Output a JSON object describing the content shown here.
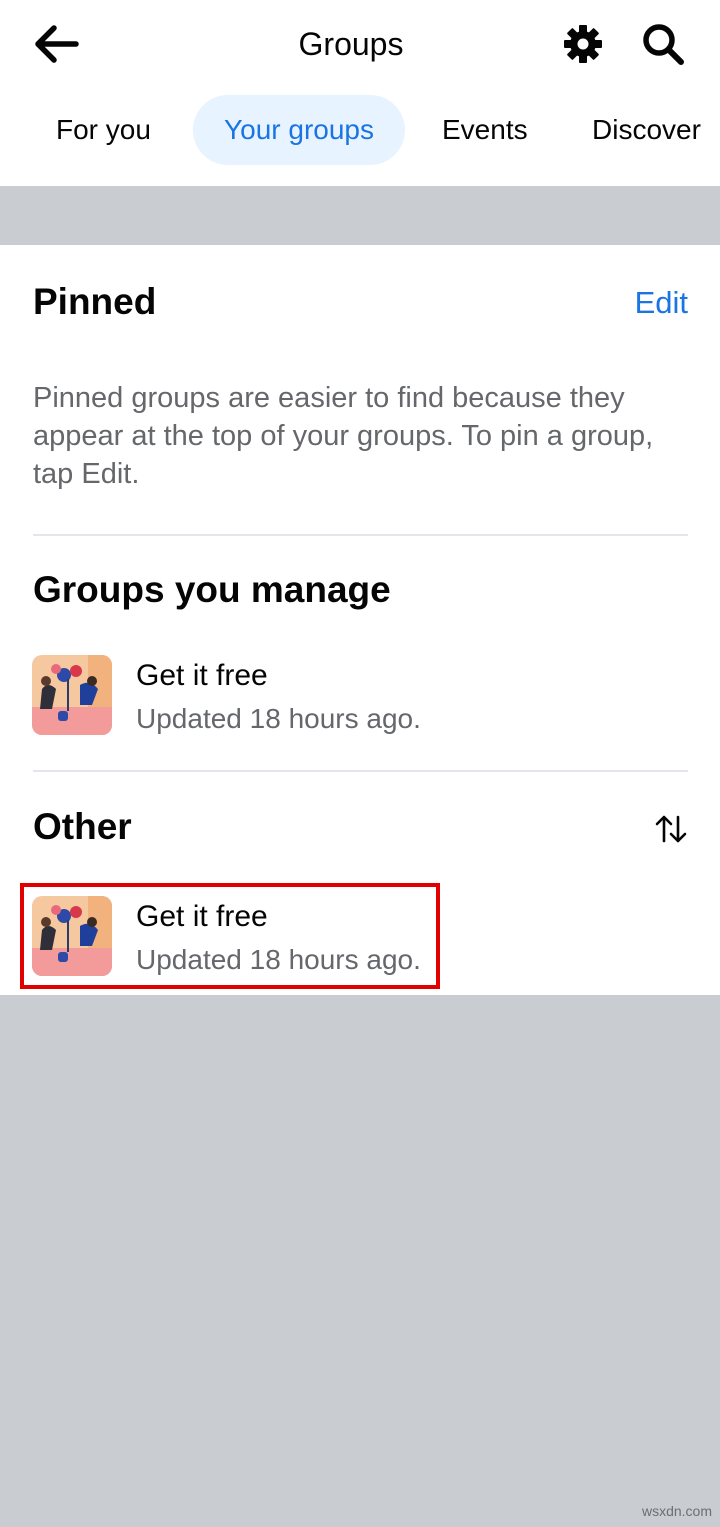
{
  "header": {
    "title": "Groups",
    "icons": {
      "back": "back-arrow-icon",
      "settings": "gear-icon",
      "search": "search-icon"
    }
  },
  "tabs": [
    {
      "label": "For you",
      "active": false
    },
    {
      "label": "Your groups",
      "active": true
    },
    {
      "label": "Events",
      "active": false
    },
    {
      "label": "Discover",
      "active": false
    }
  ],
  "pinned": {
    "title": "Pinned",
    "edit_label": "Edit",
    "description": "Pinned groups are easier to find because they appear at the top of your groups. To pin a group, tap Edit."
  },
  "manage": {
    "title": "Groups you manage",
    "groups": [
      {
        "name": "Get it free",
        "updated": "Updated 18 hours ago."
      }
    ]
  },
  "other": {
    "title": "Other",
    "sort_icon": "sort-arrows-icon",
    "groups": [
      {
        "name": "Get it free",
        "updated": "Updated 18 hours ago.",
        "highlighted": true
      }
    ]
  },
  "watermark": "wsxdn.com",
  "colors": {
    "accent": "#1b74e4",
    "active_tab_bg": "#e7f3ff",
    "highlight_border": "#e00000",
    "page_bg": "#c9ccd1"
  }
}
